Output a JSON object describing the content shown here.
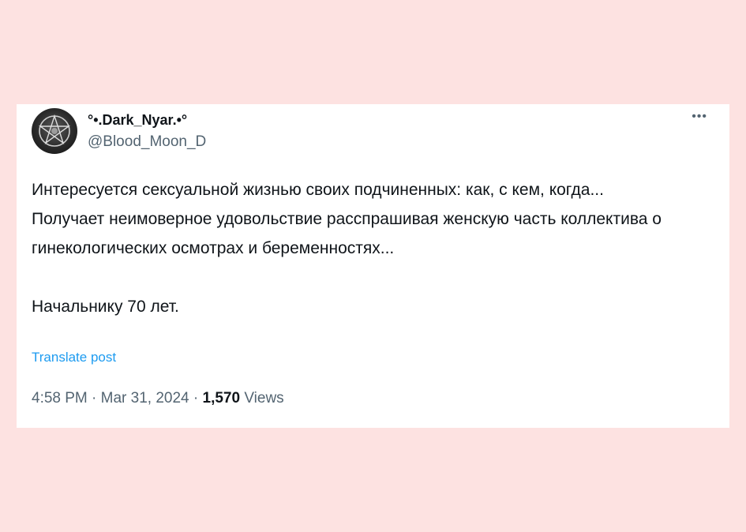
{
  "tweet": {
    "display_name": "°•.Dark_Nyar.•°",
    "handle": "@Blood_Moon_D",
    "more_icon": "more-icon",
    "text_lines": [
      "Интересуется сексуальной жизнью своих подчиненных: как, с кем, когда...",
      "Получает неимоверное удовольствие расспрашивая женскую часть коллектива о гинекологических осмотрах и беременностях...",
      "Начальнику 70 лет."
    ],
    "translate_label": "Translate post",
    "time": "4:58 PM",
    "date": "Mar 31, 2024",
    "views_count": "1,570",
    "views_label": "Views",
    "separator": "·"
  },
  "colors": {
    "background": "#fde2e1",
    "card": "#ffffff",
    "text": "#0f1419",
    "secondary": "#536471",
    "link": "#1d9bf0"
  }
}
